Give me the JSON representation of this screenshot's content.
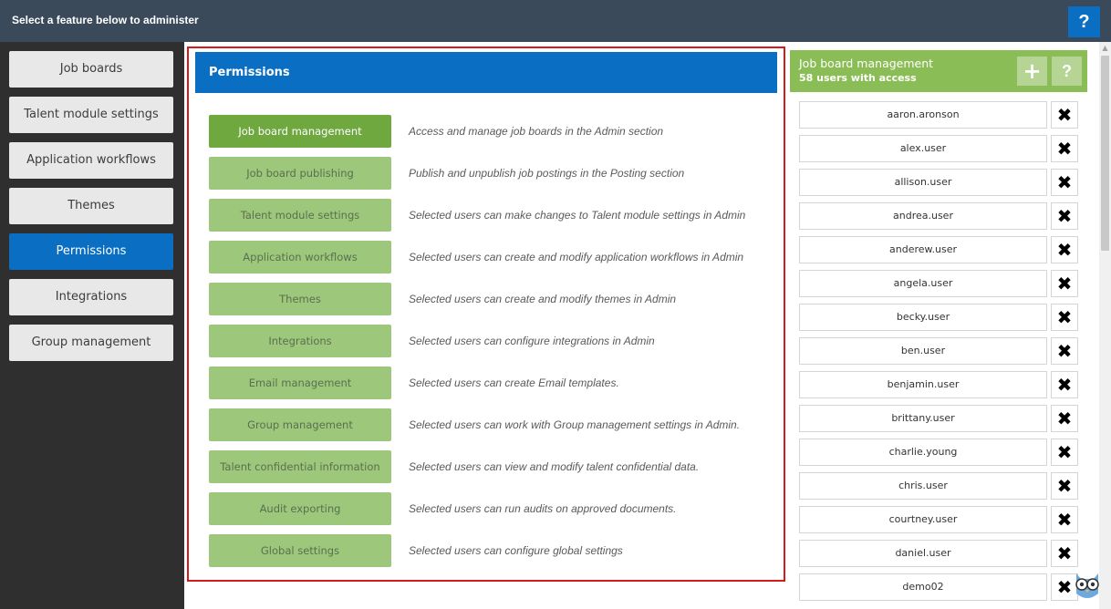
{
  "topbar": {
    "title": "Select a feature below to administer",
    "help_label": "?",
    "help_icon": "question-icon"
  },
  "sidebar": {
    "items": [
      {
        "label": "Job boards",
        "active": false
      },
      {
        "label": "Talent module settings",
        "active": false
      },
      {
        "label": "Application workflows",
        "active": false
      },
      {
        "label": "Themes",
        "active": false
      },
      {
        "label": "Permissions",
        "active": true
      },
      {
        "label": "Integrations",
        "active": false
      },
      {
        "label": "Group management",
        "active": false
      }
    ]
  },
  "permissions": {
    "title": "Permissions",
    "rows": [
      {
        "label": "Job board management",
        "desc": "Access and manage job boards in the Admin section",
        "active": true
      },
      {
        "label": "Job board publishing",
        "desc": "Publish and unpublish job postings in the Posting section",
        "active": false
      },
      {
        "label": "Talent module settings",
        "desc": "Selected users can make changes to Talent module settings in Admin",
        "active": false
      },
      {
        "label": "Application workflows",
        "desc": "Selected users can create and modify application workflows in Admin",
        "active": false
      },
      {
        "label": "Themes",
        "desc": "Selected users can create and modify themes in Admin",
        "active": false
      },
      {
        "label": "Integrations",
        "desc": "Selected users can configure integrations in Admin",
        "active": false
      },
      {
        "label": "Email management",
        "desc": "Selected users can create Email templates.",
        "active": false
      },
      {
        "label": "Group management",
        "desc": "Selected users can work with Group management settings in Admin.",
        "active": false
      },
      {
        "label": "Talent confidential information",
        "desc": "Selected users can view and modify talent confidential data.",
        "active": false
      },
      {
        "label": "Audit exporting",
        "desc": "Selected users can run audits on approved documents.",
        "active": false
      },
      {
        "label": "Global settings",
        "desc": "Selected users can configure global settings",
        "active": false
      }
    ]
  },
  "users_panel": {
    "title": "Job board management",
    "count": "58 users with access",
    "add_label": "+",
    "help_label": "?",
    "delete_label": "✖",
    "users": [
      "aaron.aronson",
      "alex.user",
      "allison.user",
      "andrea.user",
      "anderew.user",
      "angela.user",
      "becky.user",
      "ben.user",
      "benjamin.user",
      "brittany.user",
      "charlie.young",
      "chris.user",
      "courtney.user",
      "daniel.user",
      "demo02"
    ]
  },
  "colors": {
    "topbar": "#3a4a5a",
    "sidebar": "#2f2f2f",
    "accent_blue": "#0a6fc2",
    "green_active": "#6ea83f",
    "green_inactive": "#9dc77a",
    "panel_green": "#8bbd56",
    "highlight_red": "#d7191c"
  }
}
